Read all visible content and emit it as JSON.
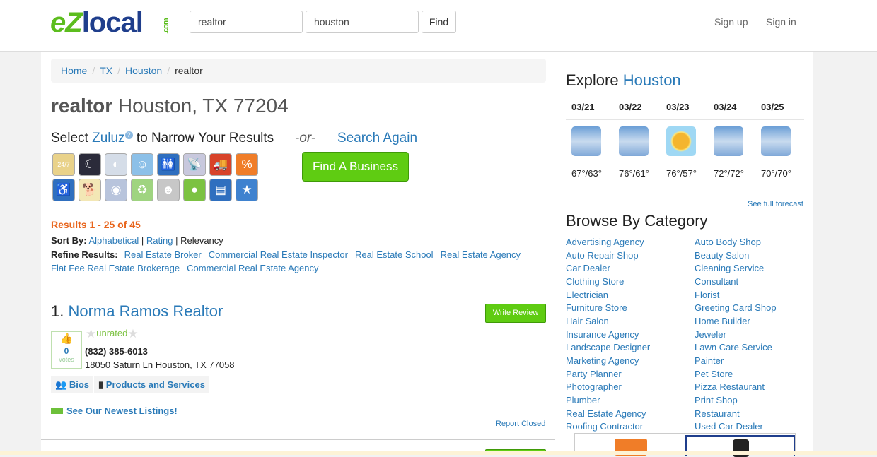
{
  "header": {
    "logo": "eZlocal.com",
    "search_what": "realtor",
    "search_where": "houston",
    "find_label": "Find",
    "signup": "Sign up",
    "signin": "Sign in"
  },
  "breadcrumb": [
    {
      "label": "Home"
    },
    {
      "label": "TX"
    },
    {
      "label": "Houston"
    },
    {
      "label": "realtor"
    }
  ],
  "title": {
    "bold": "realtor",
    "rest": " Houston, TX 77204"
  },
  "zuluz": {
    "pre": "Select ",
    "link": "Zuluz",
    "help": "?",
    "post": " to Narrow Your Results",
    "or": "-or-",
    "search_again": "Search Again",
    "find_business": "Find A Business",
    "icons": [
      {
        "name": "24-7-icon",
        "glyph": "24/7",
        "color": "#e9d28a"
      },
      {
        "name": "night-icon",
        "glyph": "☾",
        "color": "#2b2b3a"
      },
      {
        "name": "credit-card-icon",
        "glyph": "◐",
        "color": "#d5dde8"
      },
      {
        "name": "kid-icon",
        "glyph": "☺",
        "color": "#8cc0e8"
      },
      {
        "name": "restroom-icon",
        "glyph": "🚻",
        "color": "#2f6fbf"
      },
      {
        "name": "wifi-icon",
        "glyph": "📡",
        "color": "#c8c8dd"
      },
      {
        "name": "delivery-icon",
        "glyph": "🚚",
        "color": "#d8432a"
      },
      {
        "name": "sale-icon",
        "glyph": "%",
        "color": "#f07d28"
      },
      {
        "name": "wheelchair-icon",
        "glyph": "♿",
        "color": "#2f6fbf"
      },
      {
        "name": "dog-icon",
        "glyph": "🐕",
        "color": "#f3e7b5"
      },
      {
        "name": "globe-icon",
        "glyph": "◉",
        "color": "#b8c4dc"
      },
      {
        "name": "recycle-icon",
        "glyph": "♻",
        "color": "#9fd480"
      },
      {
        "name": "senior-icon",
        "glyph": "☻",
        "color": "#c7c7c7"
      },
      {
        "name": "apple-icon",
        "glyph": "●",
        "color": "#7cc242"
      },
      {
        "name": "clipboard-icon",
        "glyph": "▤",
        "color": "#2f6fbf"
      },
      {
        "name": "star-icon",
        "glyph": "★",
        "color": "#3f82cf"
      }
    ]
  },
  "results": {
    "summary": "Results 1 - 25 of 45",
    "sort_label": "Sort By:",
    "sort": [
      "Alphabetical",
      "Rating",
      "Relevancy"
    ],
    "refine_label": "Refine Results:",
    "refine": [
      "Real Estate Broker",
      "Commercial Real Estate Inspector",
      "Real Estate School",
      "Real Estate Agency",
      "Flat Fee Real Estate Brokerage",
      "Commercial Real Estate Agency"
    ]
  },
  "listing": {
    "number": "1.",
    "name": "Norma Ramos Realtor",
    "write_review": "Write Review",
    "votes": "0",
    "votes_label": "votes",
    "rating": "unrated",
    "phone": "(832) 385-6013",
    "address": "18050 Saturn Ln Houston, TX 77058",
    "bios": "Bios",
    "products": "Products and Services",
    "newest": "See Our Newest Listings!",
    "report": "Report Closed"
  },
  "explore": {
    "pre": "Explore ",
    "city": "Houston",
    "forecast": [
      {
        "date": "03/21",
        "icon": "rain",
        "temp": "67°/63°"
      },
      {
        "date": "03/22",
        "icon": "rain",
        "temp": "76°/61°"
      },
      {
        "date": "03/23",
        "icon": "sun",
        "temp": "76°/57°"
      },
      {
        "date": "03/24",
        "icon": "rain",
        "temp": "72°/72°"
      },
      {
        "date": "03/25",
        "icon": "rain",
        "temp": "70°/70°"
      }
    ],
    "full_forecast": "See full forecast"
  },
  "browse": {
    "title": "Browse By Category",
    "categories": [
      "Advertising Agency",
      "Auto Body Shop",
      "Auto Repair Shop",
      "Beauty Salon",
      "Car Dealer",
      "Cleaning Service",
      "Clothing Store",
      "Consultant",
      "Electrician",
      "Florist",
      "Furniture Store",
      "Greeting Card Shop",
      "Hair Salon",
      "Home Builder",
      "Insurance Agency",
      "Jeweler",
      "Landscape Designer",
      "Lawn Care Service",
      "Marketing Agency",
      "Painter",
      "Party Planner",
      "Pet Store",
      "Photographer",
      "Pizza Restaurant",
      "Plumber",
      "Print Shop",
      "Real Estate Agency",
      "Restaurant",
      "Roofing Contractor",
      "Used Car Dealer"
    ]
  }
}
